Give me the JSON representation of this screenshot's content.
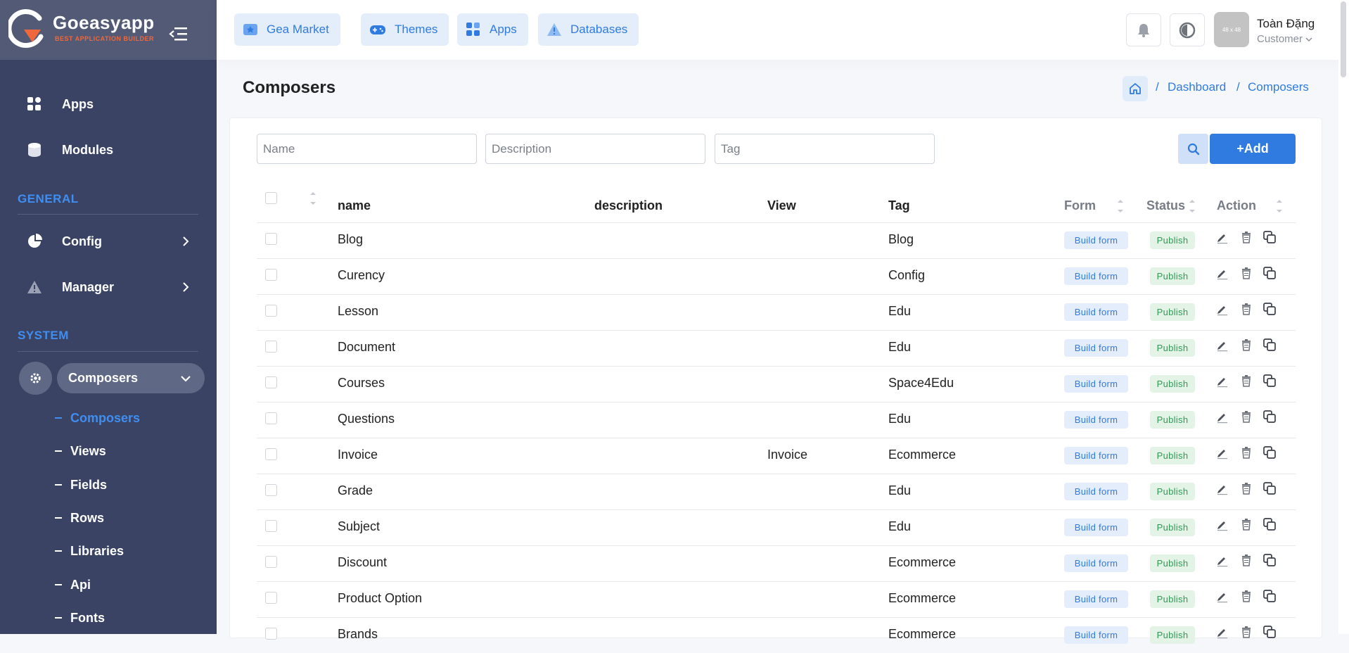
{
  "brand": {
    "name": "Goeasyapp",
    "tagline": "BEST APPLICATION BUILDER"
  },
  "sidebar": {
    "items": [
      {
        "label": "Apps",
        "icon": "grid-icon"
      },
      {
        "label": "Modules",
        "icon": "database-icon"
      }
    ],
    "general_title": "GENERAL",
    "general_items": [
      {
        "label": "Config",
        "icon": "pie-chart-icon"
      },
      {
        "label": "Manager",
        "icon": "warning-icon"
      }
    ],
    "system_title": "SYSTEM",
    "composers_group": {
      "label": "Composers",
      "icon": "gear-icon"
    },
    "sub_items": [
      {
        "label": "Composers",
        "active": true
      },
      {
        "label": "Views"
      },
      {
        "label": "Fields"
      },
      {
        "label": "Rows"
      },
      {
        "label": "Libraries"
      },
      {
        "label": "Api"
      },
      {
        "label": "Fonts"
      }
    ]
  },
  "topbar": {
    "buttons": [
      {
        "label": "Gea Market",
        "icon": "star-badge-icon"
      },
      {
        "label": "Themes",
        "icon": "gamepad-icon"
      },
      {
        "label": "Apps",
        "icon": "grid-icon"
      },
      {
        "label": "Databases",
        "icon": "warning-icon"
      }
    ],
    "avatar_text": "48 x 48",
    "user_name": "Toàn Đặng",
    "user_role": "Customer"
  },
  "page": {
    "title": "Composers",
    "breadcrumb": [
      "Dashboard",
      "Composers"
    ]
  },
  "filters": {
    "name_placeholder": "Name",
    "description_placeholder": "Description",
    "tag_placeholder": "Tag",
    "add_label": "+Add"
  },
  "table": {
    "headers": {
      "name": "name",
      "description": "description",
      "view": "View",
      "tag": "Tag",
      "form": "Form",
      "status": "Status",
      "action": "Action"
    },
    "build_label": "Build form",
    "status_label": "Publish",
    "rows": [
      {
        "name": "Blog",
        "description": "",
        "view": "",
        "tag": "Blog"
      },
      {
        "name": "Curency",
        "description": "",
        "view": "",
        "tag": "Config"
      },
      {
        "name": "Lesson",
        "description": "",
        "view": "",
        "tag": "Edu"
      },
      {
        "name": "Document",
        "description": "",
        "view": "",
        "tag": "Edu"
      },
      {
        "name": "Courses",
        "description": "",
        "view": "",
        "tag": "Space4Edu"
      },
      {
        "name": "Questions",
        "description": "",
        "view": "",
        "tag": "Edu"
      },
      {
        "name": "Invoice",
        "description": "",
        "view": "Invoice",
        "tag": "Ecommerce"
      },
      {
        "name": "Grade",
        "description": "",
        "view": "",
        "tag": "Edu"
      },
      {
        "name": "Subject",
        "description": "",
        "view": "",
        "tag": "Edu"
      },
      {
        "name": "Discount",
        "description": "",
        "view": "",
        "tag": "Ecommerce"
      },
      {
        "name": "Product Option",
        "description": "",
        "view": "",
        "tag": "Ecommerce"
      },
      {
        "name": "Brands",
        "description": "",
        "view": "",
        "tag": "Ecommerce"
      }
    ]
  },
  "colors": {
    "sidebar": "#3a4363",
    "accent": "#2f7be0",
    "brand_orange": "#f0673b",
    "publish_green": "#2f9a55"
  }
}
